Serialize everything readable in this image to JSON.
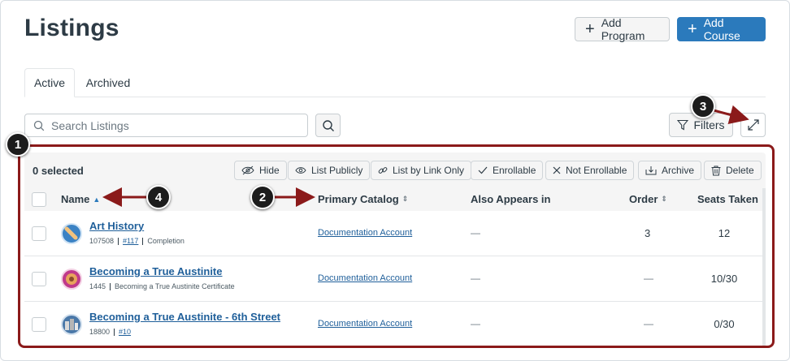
{
  "page": {
    "title": "Listings"
  },
  "header": {
    "add_program": "Add Program",
    "add_course": "Add Course"
  },
  "tabs": [
    {
      "label": "Active",
      "active": true
    },
    {
      "label": "Archived",
      "active": false
    }
  ],
  "search": {
    "placeholder": "Search Listings",
    "value": ""
  },
  "filters": {
    "label": "Filters"
  },
  "bulk": {
    "selected": "0 selected",
    "actions": [
      {
        "label": "Hide",
        "icon": "eye-slash-icon"
      },
      {
        "label": "List Publicly",
        "icon": "eye-icon"
      },
      {
        "label": "List by Link Only",
        "icon": "link-icon"
      },
      {
        "label": "Enrollable",
        "icon": "check-icon"
      },
      {
        "label": "Not Enrollable",
        "icon": "x-icon"
      },
      {
        "label": "Archive",
        "icon": "archive-icon"
      },
      {
        "label": "Delete",
        "icon": "trash-icon"
      }
    ]
  },
  "table": {
    "columns": [
      "Name",
      "Primary Catalog",
      "Also Appears in",
      "Order",
      "Seats Taken"
    ],
    "rows": [
      {
        "name": "Art History",
        "id": "107508",
        "link": "#117",
        "tag": "Completion",
        "catalog": "Documentation Account",
        "also": "—",
        "order": "3",
        "seats": "12"
      },
      {
        "name": "Becoming a True Austinite",
        "id": "1445",
        "link": "",
        "tag": "Becoming a True Austinite Certificate",
        "catalog": "Documentation Account",
        "also": "—",
        "order": "—",
        "seats": "10/30"
      },
      {
        "name": "Becoming a True Austinite - 6th Street",
        "id": "18800",
        "link": "#10",
        "tag": "",
        "catalog": "Documentation Account",
        "also": "—",
        "order": "—",
        "seats": "0/30"
      }
    ]
  },
  "callouts": [
    "1",
    "2",
    "3",
    "4"
  ],
  "colors": {
    "primary": "#2b7abc",
    "callout": "#8b1a1a",
    "link": "#1f5f9a"
  }
}
